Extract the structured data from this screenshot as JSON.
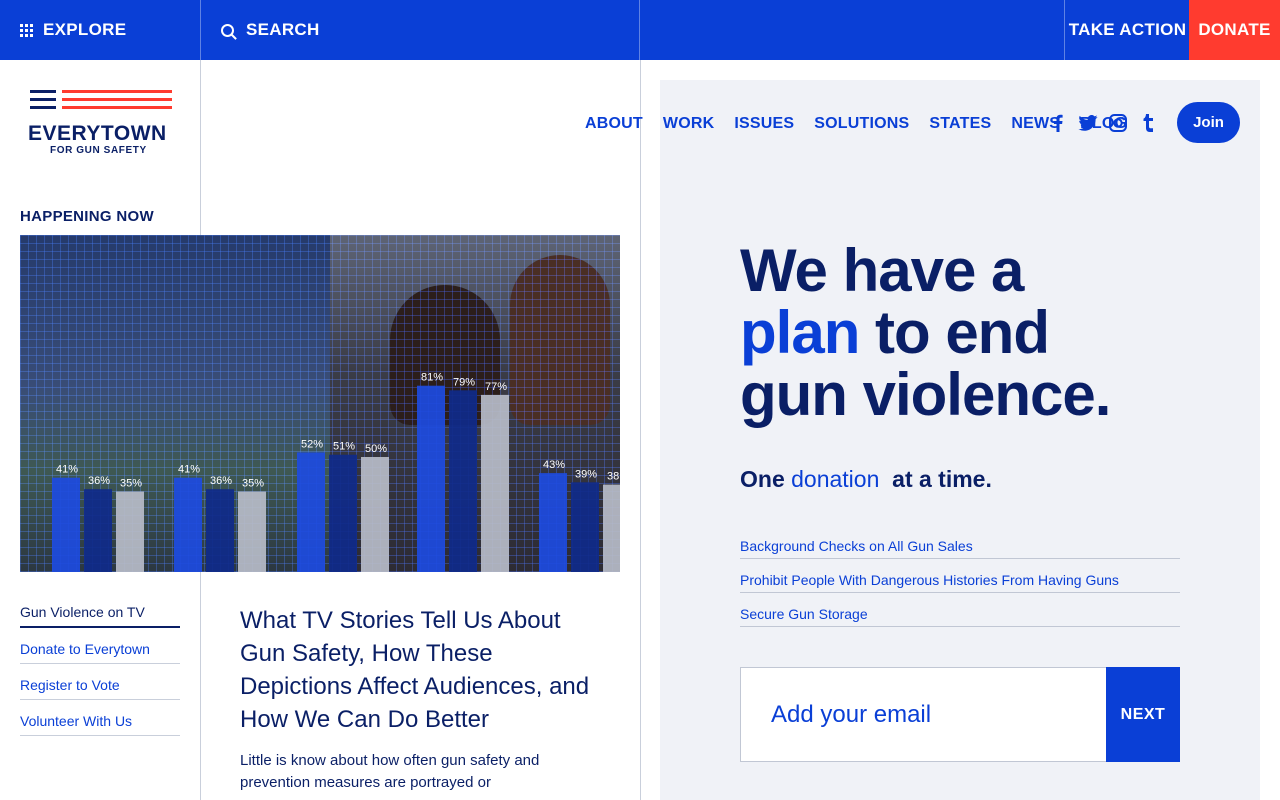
{
  "topbar": {
    "explore_label": "EXPLORE",
    "search_label": "SEARCH",
    "take_action_label": "TAKE ACTION",
    "donate_label": "DONATE"
  },
  "logo": {
    "wordmark": "EVERYTOWN",
    "tagline": "FOR GUN SAFETY"
  },
  "nav": {
    "items": [
      "ABOUT",
      "WORK",
      "ISSUES",
      "SOLUTIONS",
      "STATES",
      "NEWS",
      "BLOG"
    ],
    "social_icons": [
      "facebook-icon",
      "twitter-icon",
      "instagram-icon",
      "tumblr-icon"
    ],
    "join_label": "Join"
  },
  "happening": {
    "heading": "HAPPENING NOW",
    "chart_labels": [
      "41%",
      "36%",
      "35%",
      "41%",
      "36%",
      "35%",
      "52%",
      "51%",
      "50%",
      "81%",
      "79%",
      "77%",
      "43%",
      "39%",
      "38"
    ],
    "sidebar_links": [
      "Gun Violence on TV",
      "Donate to Everytown",
      "Register to Vote",
      "Volunteer With Us"
    ],
    "article_title": "What TV Stories Tell Us About Gun Safety, How These Depictions Affect Audiences, and How We Can Do Better",
    "article_body": "Little is know about how often gun safety and prevention measures are portrayed or"
  },
  "hero": {
    "headline_line1": "We have a",
    "headline_plan": "plan",
    "headline_line2_rest": " to end",
    "headline_line3": "gun violence.",
    "sub_start": "One ",
    "sub_highlight": "donation",
    "sub_end": "  at a time.",
    "links": [
      "Background Checks on All Gun Sales",
      "Prohibit People With Dangerous Histories From Having Guns",
      "Secure Gun Storage"
    ],
    "email_placeholder": "Add your email",
    "next_label": "NEXT"
  },
  "colors": {
    "brand_blue": "#0a3fd6",
    "navy": "#0a1f66",
    "donate_red": "#ff3b2f",
    "panel_bg": "#f0f2f7"
  }
}
